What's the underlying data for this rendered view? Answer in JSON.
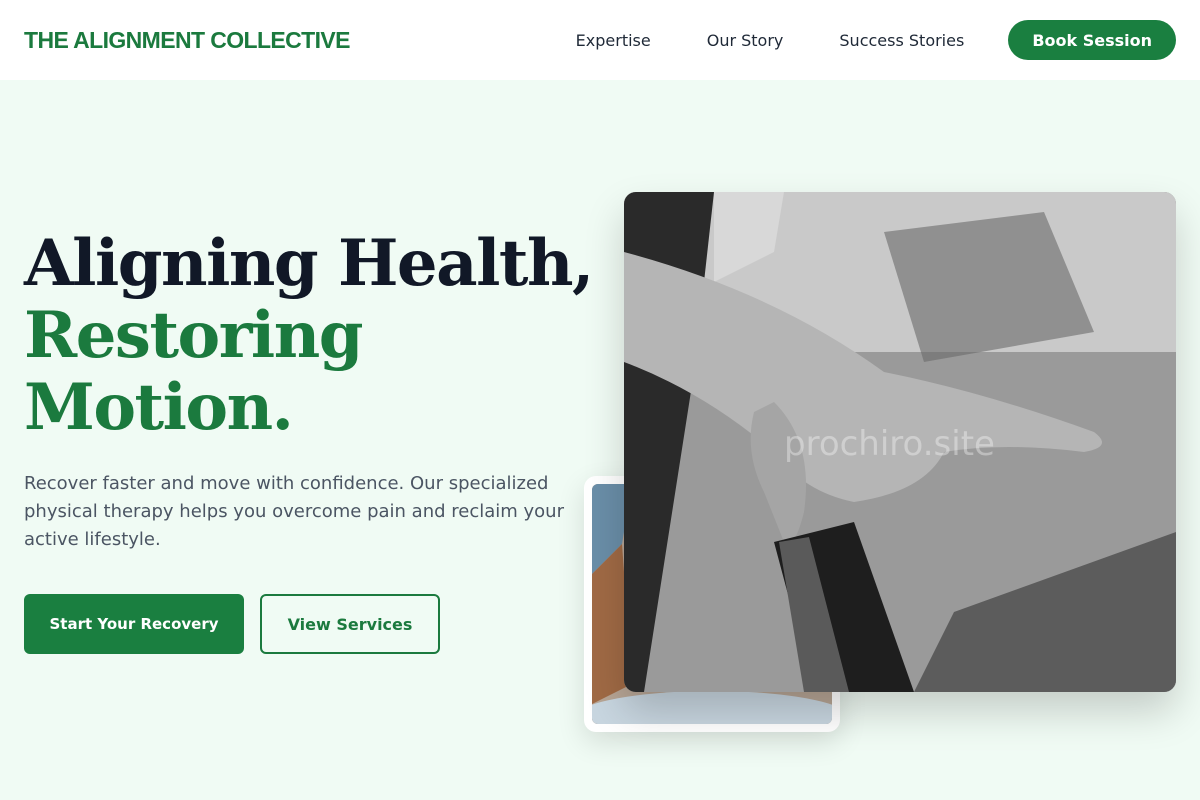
{
  "header": {
    "logo": "THE ALIGNMENT COLLECTIVE",
    "nav": [
      "Expertise",
      "Our Story",
      "Success Stories"
    ],
    "cta": "Book Session"
  },
  "hero": {
    "title_line1": "Aligning Health,",
    "title_line2": "Restoring",
    "title_line3": "Motion.",
    "subtitle": "Recover faster and move with confidence. Our specialized physical therapy helps you overcome pain and reclaim your active lifestyle.",
    "primary_button": "Start Your Recovery",
    "secondary_button": "View Services"
  },
  "images": {
    "watermark": "prochiro.site"
  },
  "colors": {
    "brand_green": "#1a7f40",
    "background": "#f0fbf4",
    "heading_dark": "#111827",
    "body_text": "#4b5563"
  }
}
